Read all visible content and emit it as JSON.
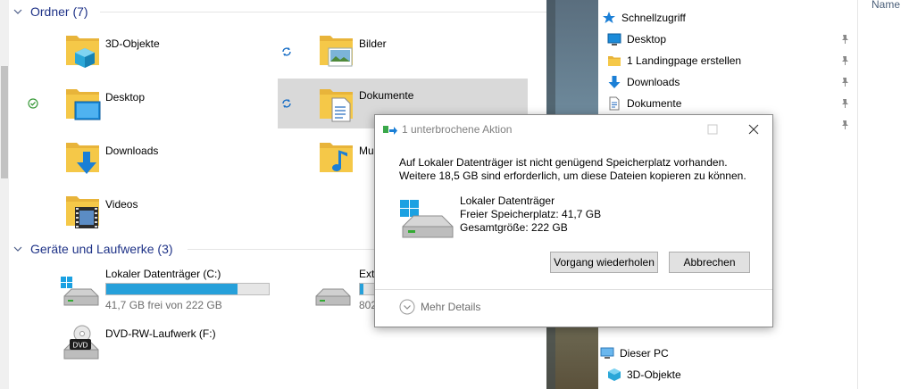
{
  "explorer": {
    "groups": {
      "folders": {
        "label": "Ordner (7)"
      },
      "devices": {
        "label": "Geräte und Laufwerke (3)"
      }
    },
    "folders": [
      {
        "label": "3D-Objekte",
        "icon": "3d-objects-icon"
      },
      {
        "label": "Bilder",
        "icon": "pictures-icon"
      },
      {
        "label": "Desktop",
        "icon": "desktop-icon"
      },
      {
        "label": "Dokumente",
        "icon": "documents-icon"
      },
      {
        "label": "Downloads",
        "icon": "downloads-icon"
      },
      {
        "label": "Mu",
        "icon": "music-icon"
      },
      {
        "label": "Videos",
        "icon": "videos-icon"
      }
    ],
    "drives": [
      {
        "name": "Lokaler Datenträger (C:)",
        "info": "41,7 GB frei von 222 GB",
        "used_fraction": 0.81
      },
      {
        "name": "Ext",
        "info": "802",
        "used_fraction": 0.2
      },
      {
        "name": "DVD-RW-Laufwerk (F:)",
        "info": "",
        "badge": "DVD"
      }
    ]
  },
  "nav": {
    "quick_access": "Schnellzugriff",
    "items": [
      {
        "label": "Desktop",
        "icon": "desktop-icon"
      },
      {
        "label": "1 Landingpage erstellen",
        "icon": "folder-icon"
      },
      {
        "label": "Downloads",
        "icon": "downloads-icon"
      },
      {
        "label": "Dokumente",
        "icon": "documents-icon"
      }
    ],
    "this_pc": "Dieser PC",
    "this_pc_child": "3D-Objekte",
    "column_header": "Name"
  },
  "dialog": {
    "title": "1 unterbrochene Aktion",
    "message_line1": "Auf Lokaler Datenträger ist nicht genügend Speicherplatz vorhanden.",
    "message_line2": "Weitere 18,5 GB sind erforderlich, um diese Dateien kopieren zu können.",
    "drive_name": "Lokaler Datenträger",
    "free_space": "Freier Speicherplatz: 41,7 GB",
    "total_size": "Gesamtgröße: 222 GB",
    "retry_label": "Vorgang wiederholen",
    "cancel_label": "Abbrechen",
    "more_details": "Mehr Details"
  },
  "colors": {
    "accent": "#0078d7",
    "group_header": "#1e3287",
    "drive_bar": "#26a0da",
    "folder": "#f5c848"
  }
}
